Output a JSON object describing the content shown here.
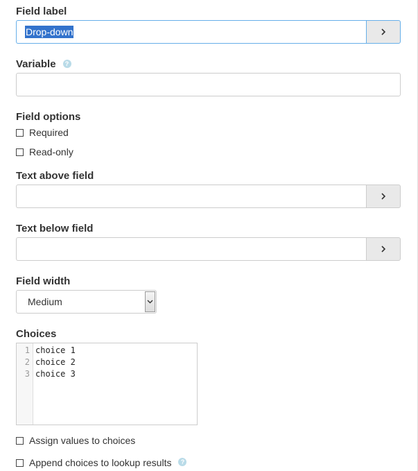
{
  "field_label": {
    "label": "Field label",
    "value": "Drop-down",
    "button": ">"
  },
  "variable": {
    "label": "Variable",
    "help_icon": "question-circle-icon",
    "value": ""
  },
  "field_options": {
    "label": "Field options",
    "required": {
      "label": "Required",
      "checked": false
    },
    "read_only": {
      "label": "Read-only",
      "checked": false
    }
  },
  "text_above_field": {
    "label": "Text above field",
    "value": "",
    "button": ">"
  },
  "text_below_field": {
    "label": "Text below field",
    "value": "",
    "button": ">"
  },
  "field_width": {
    "label": "Field width",
    "selected": "Medium"
  },
  "choices": {
    "label": "Choices",
    "line_numbers": [
      "1",
      "2",
      "3"
    ],
    "lines": [
      "choice 1",
      "choice 2",
      "choice 3"
    ]
  },
  "assign_values": {
    "label": "Assign values to choices",
    "checked": false
  },
  "append_choices": {
    "label": "Append choices to lookup results",
    "checked": false,
    "help_icon": "question-circle-icon"
  },
  "colors": {
    "focus_border": "#66afe9",
    "selection_bg": "#3373cc",
    "addon_bg": "#e9e9e9",
    "help_icon": "#b9dbe8"
  }
}
